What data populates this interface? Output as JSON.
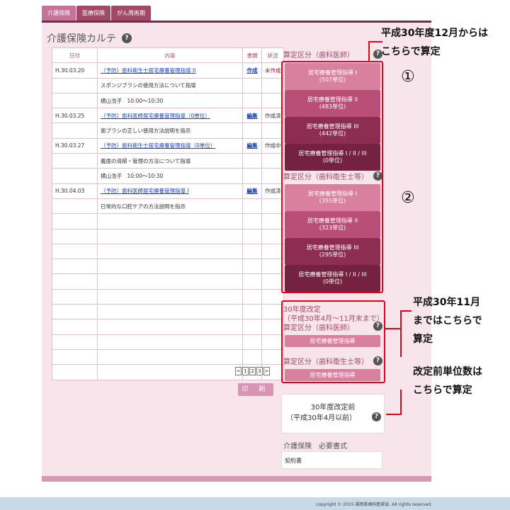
{
  "tabs": [
    "介護保険",
    "医療保険",
    "がん周術期"
  ],
  "page_title": "介護保険カルテ",
  "table": {
    "headers": [
      "日付",
      "内容",
      "書類",
      "状況"
    ],
    "rows": [
      {
        "date": "H.30.03.20",
        "content": "（予防）歯科衛生士居宅療養管理指導 II",
        "doc": "作成",
        "status": "未作成",
        "link": true
      },
      {
        "date": "",
        "content": "スポンジブラシの使用方法について指導",
        "doc": "",
        "status": "",
        "link": false
      },
      {
        "date": "",
        "content": "横山浩子　10:00〜10:30",
        "doc": "",
        "status": "",
        "link": false
      },
      {
        "date": "H.30.03.25",
        "content": "（予防）歯科医師居宅療養管理指導（0単位）",
        "doc": "編集",
        "status": "作成済",
        "link": true
      },
      {
        "date": "",
        "content": "歯ブラシの正しい使用方法説明を指示",
        "doc": "",
        "status": "",
        "link": false
      },
      {
        "date": "H.30.03.27",
        "content": "（予防）歯科衛生士居宅療養管理指導（0単位）",
        "doc": "編集",
        "status": "作成中",
        "link": true
      },
      {
        "date": "",
        "content": "義歯の清掃・管理の方法について指導",
        "doc": "",
        "status": "",
        "link": false
      },
      {
        "date": "",
        "content": "横山浩子　10:00〜10:30",
        "doc": "",
        "status": "",
        "link": false
      },
      {
        "date": "H.30.04.03",
        "content": "（予防）歯科医師居宅療養管理指導 I",
        "doc": "編集",
        "status": "作成済",
        "link": true
      },
      {
        "date": "",
        "content": "日常的な口腔ケアの方法説明を指示",
        "doc": "",
        "status": "",
        "link": false
      }
    ],
    "empty_rows": 11
  },
  "pager": [
    "<",
    "1",
    "2",
    "3",
    ">"
  ],
  "print_label": "印 刷",
  "right": {
    "section1_label": "算定区分（歯科医師）",
    "dentist_buttons": [
      {
        "l1": "居宅療養管理指導 I",
        "l2": "(507単位)"
      },
      {
        "l1": "居宅療養管理指導 II",
        "l2": "(483単位)"
      },
      {
        "l1": "居宅療養管理指導 III",
        "l2": "(442単位)"
      },
      {
        "l1": "居宅療養管理指導 I / II / III",
        "l2": "(0単位)"
      }
    ],
    "section2_label": "算定区分（歯科衛生士等）",
    "hygienist_buttons": [
      {
        "l1": "居宅療養管理指導 I",
        "l2": "(355単位)"
      },
      {
        "l1": "居宅療養管理指導 II",
        "l2": "(323単位)"
      },
      {
        "l1": "居宅療養管理指導 III",
        "l2": "(295単位)"
      },
      {
        "l1": "居宅療養管理指導 I / II / III",
        "l2": "(0単位)"
      }
    ],
    "revision_line1": "30年度改定",
    "revision_line2": "（平成30年4月〜11月末まで）",
    "revision_dentist_label": "算定区分（歯科医師）",
    "revision_dentist_button": "居宅療養管理指導",
    "revision_hygienist_label": "算定区分（歯科衛生士等）",
    "revision_hygienist_button": "居宅療養管理指導",
    "pre_revision_line1": "30年度改定前",
    "pre_revision_line2": "（平成30年4月以前）",
    "required_docs_label": "介護保険　必要書式",
    "contract_label": "契約書"
  },
  "callouts": {
    "dec_line1": "平成30年度12月からは",
    "dec_line2": "こちらで算定",
    "num1": "①",
    "num2": "②",
    "nov_line1": "平成30年11月",
    "nov_line2": "まではこちらで",
    "nov_line3": "算定",
    "pre_line1": "改定前単位数は",
    "pre_line2": "こちらで算定"
  },
  "copyright": "copyright © 2015 福岡県歯科医師会. All rights reserved.",
  "help_glyph": "?"
}
